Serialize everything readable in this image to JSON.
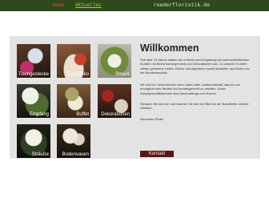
{
  "nav": {
    "home": "Home",
    "news": "Aktuelles"
  },
  "site": {
    "domain": "roederfloristik.de"
  },
  "tiles": [
    {
      "label": "Tischgestecke"
    },
    {
      "label": "Tischdeko"
    },
    {
      "label": "Strauß"
    },
    {
      "label": "Empfang"
    },
    {
      "label": "Buffet"
    },
    {
      "label": "Dekorationen"
    },
    {
      "label": "Sträuße"
    },
    {
      "label": "Bodenvasen"
    }
  ],
  "content": {
    "title": "Willkommen",
    "p1": "Seit über 15 Jahren statten wir in Berlin und Umgebung die unterschiedlichsten Kunden mit Blumenarrangements und Dekorationen aus. Zu unseren Kunden zählen gehobene Hotels, Bühne und Agenturen sowie Aussteller aus Berlin und der Bundesrepublik.",
    "p2": "Wir sind ein Unternehmen ohne Laden oder Laufkundschaft, was es uns ermöglicht sehr flexibel und kundengerecht zu arbeiten. Unser Hauptgeschäftsbereich sind Dauerauftrage und Events.",
    "p3": "Schauen Sie sich um und machen Sie sich ein Bild von der Bandbreite unserer Arbeiten.",
    "signature": "Alexandra Röder",
    "contact_label": "Kontakt"
  },
  "colors": {
    "topbar": "#2c4a1c",
    "nav_active": "#e24c2f",
    "nav_link": "#b7c53c",
    "panel": "#e3e3e3",
    "contact_button": "#5a1616"
  }
}
